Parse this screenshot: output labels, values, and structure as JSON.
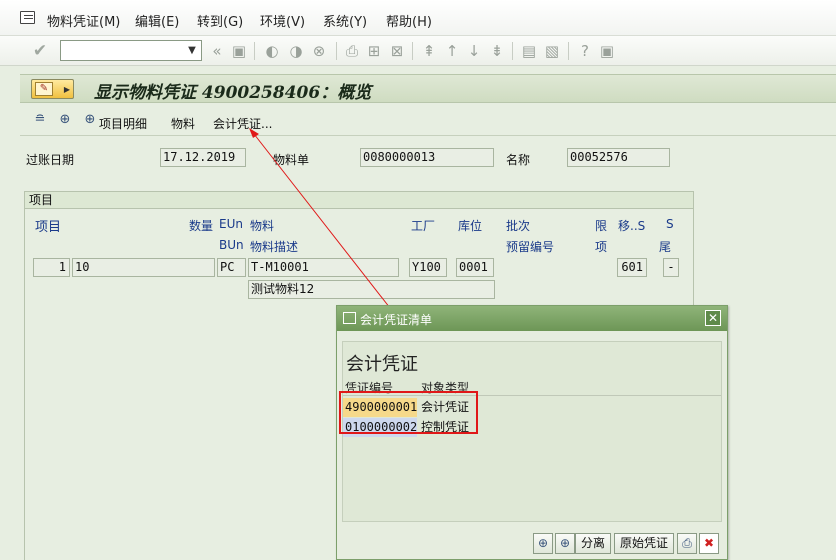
{
  "menubar": {
    "items": [
      "物料凭证(M)",
      "编辑(E)",
      "转到(G)",
      "环境(V)",
      "系统(Y)",
      "帮助(H)"
    ]
  },
  "toolbar": {
    "command_value": ""
  },
  "title": {
    "text": "显示物料凭证 4900258406：概览"
  },
  "app_toolbar": {
    "detail_label": "项目明细",
    "material_label": "物料",
    "accounting_label": "会计凭证..."
  },
  "header": {
    "posting_date_label": "过账日期",
    "posting_date": "17.12.2019",
    "material_slip_label": "物料单",
    "material_slip": "0080000013",
    "name_label": "名称",
    "name": "00052576"
  },
  "items": {
    "section_title": "项目",
    "columns_row1": [
      "项目",
      "数量",
      "EUn",
      "物料",
      "工厂",
      "库位",
      "批次",
      "限",
      "移..S",
      "S"
    ],
    "columns_row2": [
      "BUn",
      "物料描述",
      "预留编号",
      "项",
      "尾"
    ],
    "rows": [
      {
        "item": "1",
        "quantity": "10",
        "unit": "PC",
        "material": "T-M10001",
        "plant": "Y100",
        "storage": "0001",
        "movement": "601",
        "s": "-",
        "description": "测试物料12"
      }
    ]
  },
  "popup": {
    "title": "会计凭证清单",
    "heading": "会计凭证",
    "col_doc_no": "凭证编号",
    "col_obj_type": "对象类型",
    "rows": [
      {
        "doc_no": "4900000001",
        "obj_type": "会计凭证"
      },
      {
        "doc_no": "0100000002",
        "obj_type": "控制凭证"
      }
    ],
    "split_label": "分离",
    "original_label": "原始凭证"
  },
  "colors": {
    "highlight_border": "#e01818",
    "popup_title_bg": "#7aa363",
    "row1_id_bg": "#f6d98a",
    "row2_id_bg": "#cdd8ee"
  }
}
